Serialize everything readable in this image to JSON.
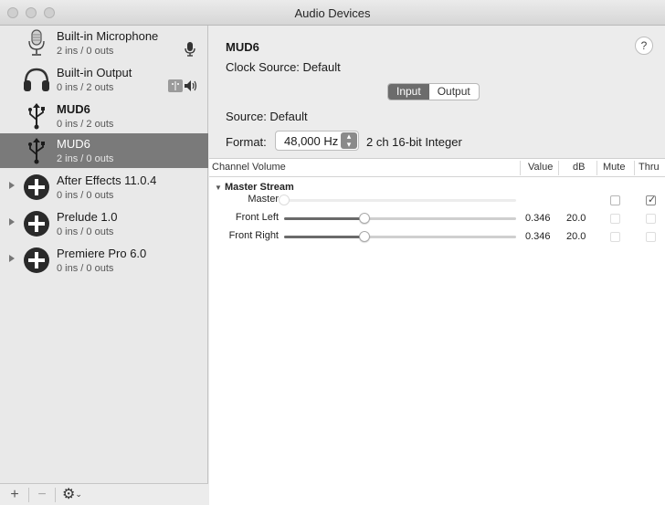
{
  "window": {
    "title": "Audio Devices"
  },
  "sidebar": {
    "devices": [
      {
        "name": "Built-in Microphone",
        "io": "2 ins / 0 outs",
        "icon": "microphone-icon",
        "status_icon": "microphone-icon",
        "expandable": false,
        "selected": false
      },
      {
        "name": "Built-in Output",
        "io": "0 ins / 2 outs",
        "icon": "headphones-icon",
        "status_icon": "finder-speaker-icon",
        "expandable": false,
        "selected": false
      },
      {
        "name": "MUD6",
        "io": "0 ins / 2 outs",
        "icon": "usb-icon",
        "expandable": false,
        "selected": false
      },
      {
        "name": "MUD6",
        "io": "2 ins / 0 outs",
        "icon": "usb-icon",
        "expandable": false,
        "selected": true
      },
      {
        "name": "After Effects 11.0.4",
        "io": "0 ins / 0 outs",
        "icon": "aggregate-plus-icon",
        "expandable": true,
        "selected": false
      },
      {
        "name": "Prelude 1.0",
        "io": "0 ins / 0 outs",
        "icon": "aggregate-plus-icon",
        "expandable": true,
        "selected": false
      },
      {
        "name": "Premiere Pro 6.0",
        "io": "0 ins / 0 outs",
        "icon": "aggregate-plus-icon",
        "expandable": true,
        "selected": false
      }
    ],
    "bottom": {
      "add": "+",
      "remove": "−",
      "gear": "⚙"
    }
  },
  "detail": {
    "device_title": "MUD6",
    "help": "?",
    "clock_source": "Clock Source:  Default",
    "tabs": [
      {
        "label": "Input",
        "active": true
      },
      {
        "label": "Output",
        "active": false
      }
    ],
    "source": "Source:  Default",
    "format_label": "Format:",
    "format_value": "48,000 Hz",
    "format_desc": "2 ch 16-bit Integer"
  },
  "table": {
    "headers": {
      "channel": "Channel Volume",
      "value": "Value",
      "db": "dB",
      "mute": "Mute",
      "thru": "Thru"
    },
    "group": "Master Stream",
    "rows": [
      {
        "label": "Master",
        "level": 0,
        "enabled": false,
        "value": "",
        "db": "",
        "mute": false,
        "mute_enabled": true,
        "thru": true,
        "thru_enabled": true
      },
      {
        "label": "Front Left",
        "level": 0.346,
        "enabled": true,
        "value": "0.346",
        "db": "20.0",
        "mute": false,
        "mute_enabled": false,
        "thru": false,
        "thru_enabled": false
      },
      {
        "label": "Front Right",
        "level": 0.346,
        "enabled": true,
        "value": "0.346",
        "db": "20.0",
        "mute": false,
        "mute_enabled": false,
        "thru": false,
        "thru_enabled": false
      }
    ]
  }
}
